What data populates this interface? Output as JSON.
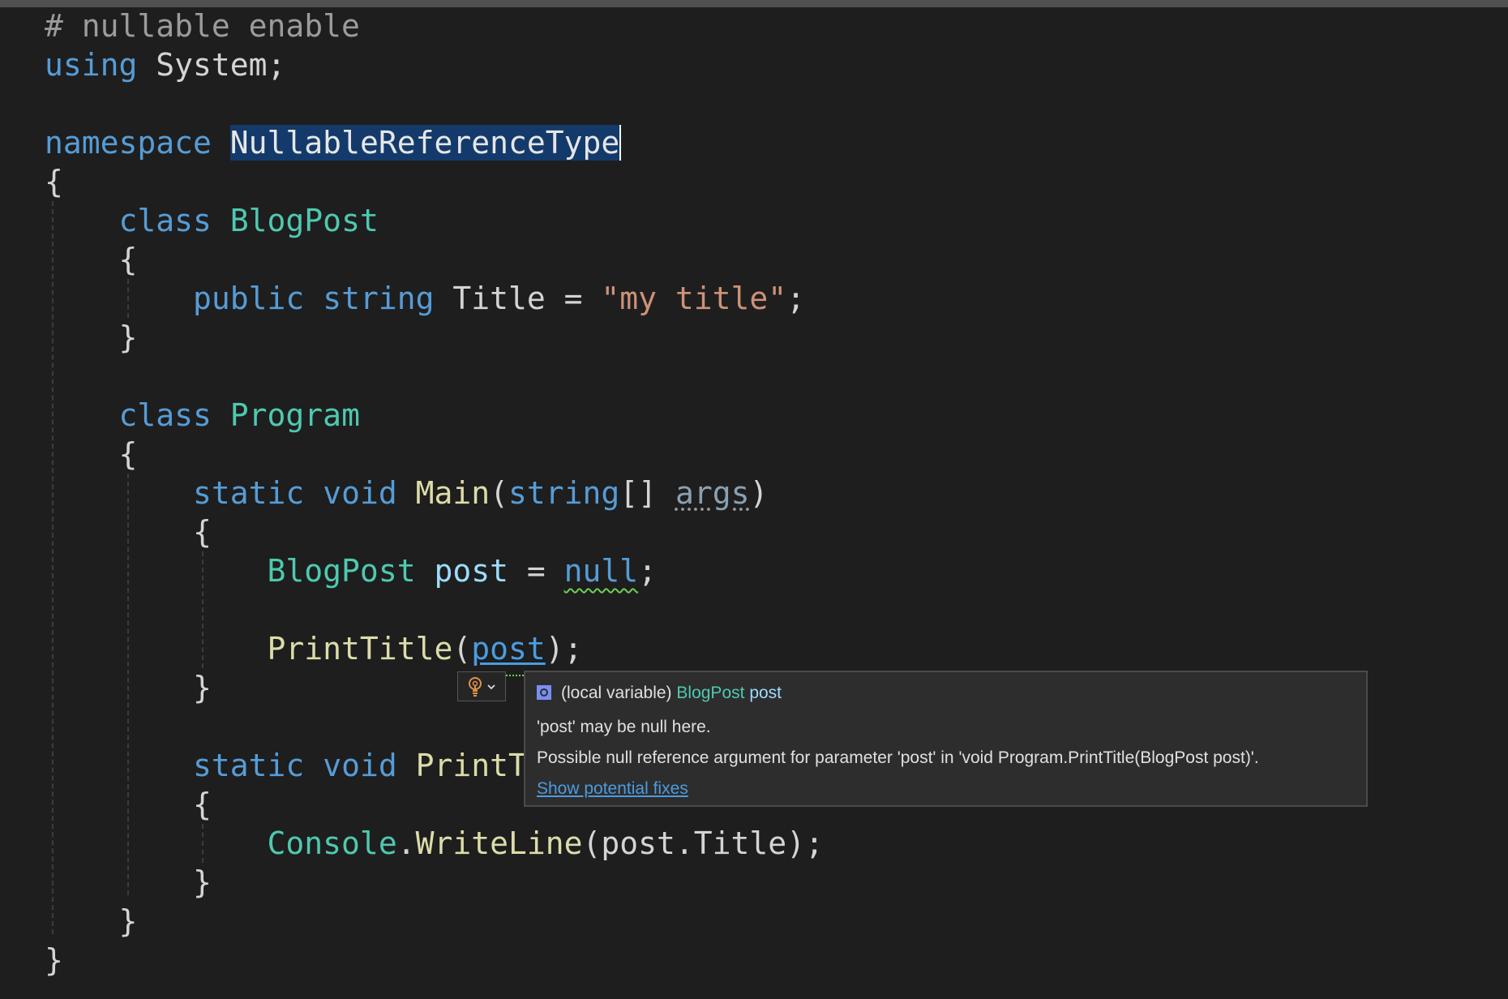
{
  "code": {
    "lines": [
      {
        "tokens": [
          {
            "text": "# nullable enable",
            "cls": "pre"
          }
        ]
      },
      {
        "tokens": [
          {
            "text": "using",
            "cls": "kw"
          },
          {
            "text": " System;",
            "cls": "txt"
          }
        ]
      },
      {
        "tokens": []
      },
      {
        "tokens": [
          {
            "text": "namespace",
            "cls": "kw"
          },
          {
            "text": " ",
            "cls": "txt"
          },
          {
            "text": "NullableReferenceType",
            "cls": "sel"
          }
        ]
      },
      {
        "tokens": [
          {
            "text": "{",
            "cls": "txt"
          }
        ]
      },
      {
        "tokens": [
          {
            "text": "    ",
            "cls": "txt"
          },
          {
            "text": "class",
            "cls": "kw"
          },
          {
            "text": " ",
            "cls": "txt"
          },
          {
            "text": "BlogPost",
            "cls": "type"
          }
        ]
      },
      {
        "tokens": [
          {
            "text": "    {",
            "cls": "txt"
          }
        ]
      },
      {
        "tokens": [
          {
            "text": "        ",
            "cls": "txt"
          },
          {
            "text": "public",
            "cls": "kw"
          },
          {
            "text": " ",
            "cls": "txt"
          },
          {
            "text": "string",
            "cls": "kw"
          },
          {
            "text": " Title = ",
            "cls": "txt"
          },
          {
            "text": "\"my title\"",
            "cls": "str"
          },
          {
            "text": ";",
            "cls": "txt"
          }
        ]
      },
      {
        "tokens": [
          {
            "text": "    }",
            "cls": "txt"
          }
        ]
      },
      {
        "tokens": []
      },
      {
        "tokens": [
          {
            "text": "    ",
            "cls": "txt"
          },
          {
            "text": "class",
            "cls": "kw"
          },
          {
            "text": " ",
            "cls": "txt"
          },
          {
            "text": "Program",
            "cls": "type"
          }
        ]
      },
      {
        "tokens": [
          {
            "text": "    {",
            "cls": "txt"
          }
        ]
      },
      {
        "tokens": [
          {
            "text": "        ",
            "cls": "txt"
          },
          {
            "text": "static",
            "cls": "kw"
          },
          {
            "text": " ",
            "cls": "txt"
          },
          {
            "text": "void",
            "cls": "kw"
          },
          {
            "text": " ",
            "cls": "txt"
          },
          {
            "text": "Main",
            "cls": "fn"
          },
          {
            "text": "(",
            "cls": "txt"
          },
          {
            "text": "string",
            "cls": "kw"
          },
          {
            "text": "[] ",
            "cls": "txt"
          },
          {
            "text": "args",
            "cls": "unused"
          },
          {
            "text": ")",
            "cls": "txt"
          }
        ]
      },
      {
        "tokens": [
          {
            "text": "        {",
            "cls": "txt"
          }
        ]
      },
      {
        "tokens": [
          {
            "text": "            ",
            "cls": "txt"
          },
          {
            "text": "BlogPost",
            "cls": "type"
          },
          {
            "text": " ",
            "cls": "txt"
          },
          {
            "text": "post",
            "cls": "var"
          },
          {
            "text": " = ",
            "cls": "txt"
          },
          {
            "text": "null",
            "cls": "kw squig"
          },
          {
            "text": ";",
            "cls": "txt"
          }
        ]
      },
      {
        "tokens": []
      },
      {
        "tokens": [
          {
            "text": "            ",
            "cls": "txt"
          },
          {
            "text": "PrintTitle",
            "cls": "fn"
          },
          {
            "text": "(",
            "cls": "txt"
          },
          {
            "text": "post",
            "cls": "link"
          },
          {
            "text": ");",
            "cls": "txt"
          }
        ]
      },
      {
        "tokens": [
          {
            "text": "        }",
            "cls": "txt"
          }
        ]
      },
      {
        "tokens": []
      },
      {
        "tokens": [
          {
            "text": "        ",
            "cls": "txt"
          },
          {
            "text": "static",
            "cls": "kw"
          },
          {
            "text": " ",
            "cls": "txt"
          },
          {
            "text": "void",
            "cls": "kw"
          },
          {
            "text": " ",
            "cls": "txt"
          },
          {
            "text": "PrintT",
            "cls": "fn"
          }
        ]
      },
      {
        "tokens": [
          {
            "text": "        {",
            "cls": "txt"
          }
        ]
      },
      {
        "tokens": [
          {
            "text": "            ",
            "cls": "txt"
          },
          {
            "text": "Console",
            "cls": "type"
          },
          {
            "text": ".",
            "cls": "txt"
          },
          {
            "text": "WriteLine",
            "cls": "fn"
          },
          {
            "text": "(post.Title);",
            "cls": "txt"
          }
        ]
      },
      {
        "tokens": [
          {
            "text": "        }",
            "cls": "txt"
          }
        ]
      },
      {
        "tokens": [
          {
            "text": "    }",
            "cls": "txt"
          }
        ]
      },
      {
        "tokens": [
          {
            "text": "}",
            "cls": "txt"
          }
        ]
      }
    ]
  },
  "lightbulb": {
    "icon": "lightbulb-icon",
    "chevron": "chevron-down-icon"
  },
  "hover": {
    "icon": "local-variable-icon",
    "kind": "(local variable)",
    "type": "BlogPost",
    "name": "post",
    "message1": "'post' may be null here.",
    "message2": "Possible null reference argument for parameter 'post' in 'void Program.PrintTitle(BlogPost post)'.",
    "link": "Show potential fixes"
  },
  "colors": {
    "background": "#1e1e1e",
    "keyword": "#569cd6",
    "type": "#4ec9b0",
    "string": "#ce9178",
    "function": "#dcdcaa",
    "variable": "#9cdcfe",
    "warning": "#6ccf55"
  }
}
